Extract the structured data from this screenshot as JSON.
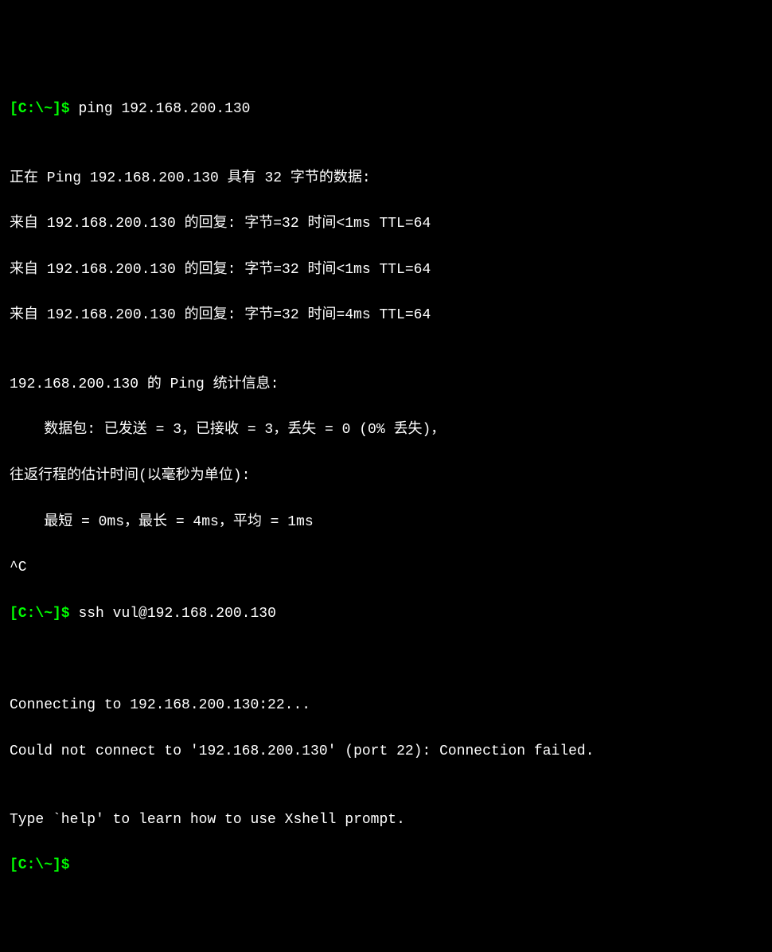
{
  "terminal": {
    "prompt": "[C:\\~]$",
    "commands": {
      "ping": "ping 192.168.200.130",
      "ssh": "ssh vul@192.168.200.130"
    },
    "ping_output": {
      "header": "正在 Ping 192.168.200.130 具有 32 字节的数据:",
      "reply1": "来自 192.168.200.130 的回复: 字节=32 时间<1ms TTL=64",
      "reply2": "来自 192.168.200.130 的回复: 字节=32 时间<1ms TTL=64",
      "reply3": "来自 192.168.200.130 的回复: 字节=32 时间=4ms TTL=64",
      "stats_header": "192.168.200.130 的 Ping 统计信息:",
      "packets": "    数据包: 已发送 = 3，已接收 = 3，丢失 = 0 (0% 丢失)，",
      "roundtrip_header": "往返行程的估计时间(以毫秒为单位):",
      "roundtrip_stats": "    最短 = 0ms，最长 = 4ms，平均 = 1ms",
      "interrupt": "^C"
    },
    "ssh_output": {
      "connecting": "Connecting to 192.168.200.130:22...",
      "failed": "Could not connect to '192.168.200.130' (port 22): Connection failed.",
      "help": "Type `help' to learn how to use Xshell prompt."
    }
  }
}
